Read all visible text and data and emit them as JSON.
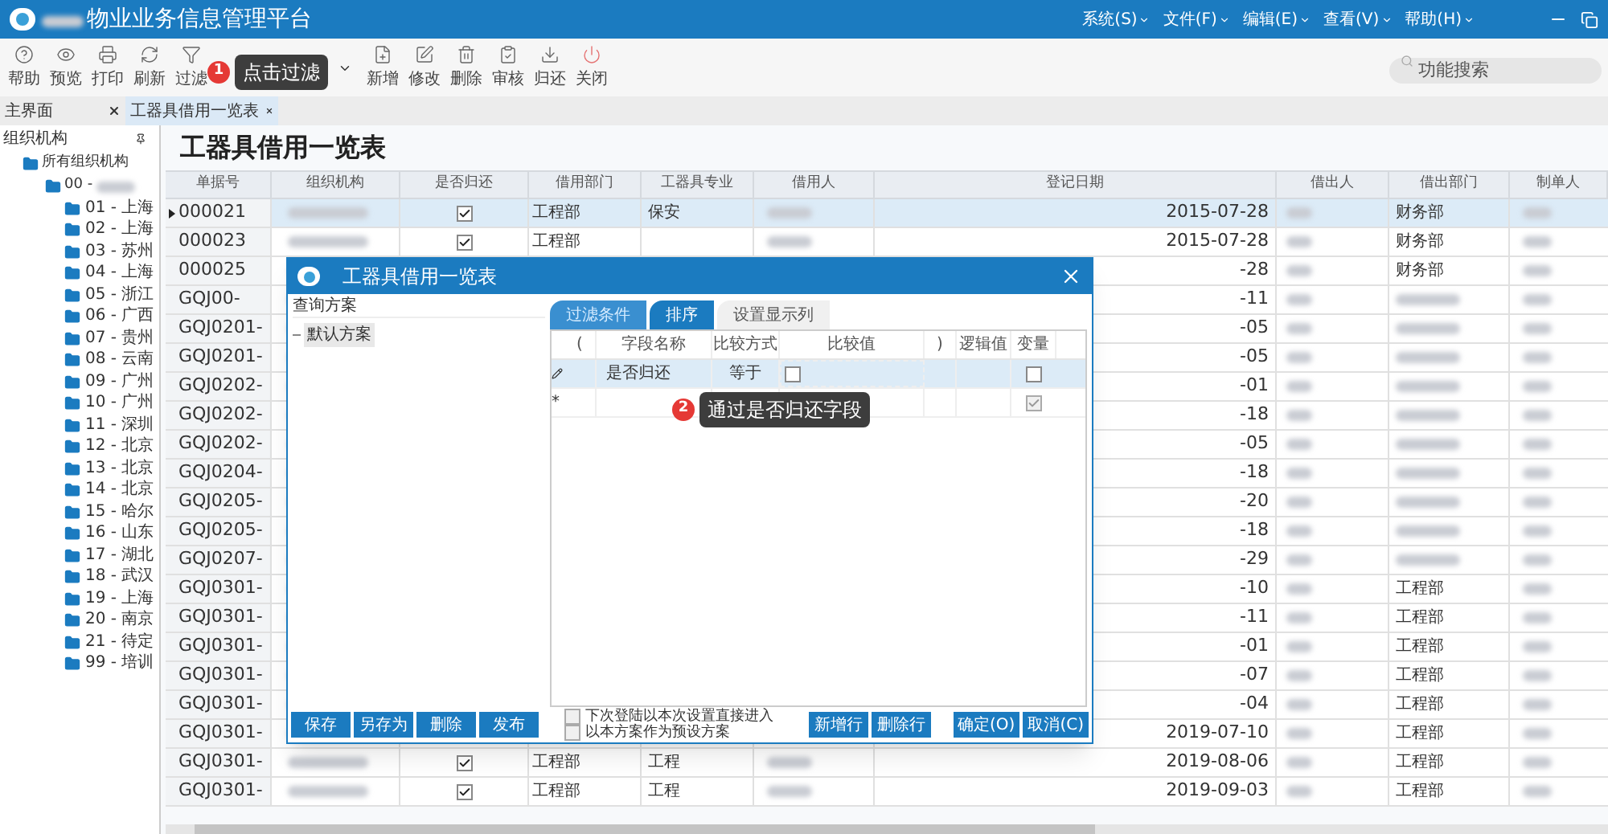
{
  "app": {
    "title": "物业业务信息管理平台",
    "menus": [
      "系统(S)",
      "文件(F)",
      "编辑(E)",
      "查看(V)",
      "帮助(H)"
    ]
  },
  "toolbar": {
    "buttons": [
      "帮助",
      "预览",
      "打印",
      "刷新",
      "过滤",
      "新增",
      "修改",
      "删除",
      "审核",
      "归还",
      "关闭"
    ],
    "callout": {
      "number": "1",
      "text": "点击过滤"
    },
    "search": {
      "placeholder": "功能搜索"
    }
  },
  "tabs": [
    {
      "label": "主界面",
      "selected": false
    },
    {
      "label": "工器具借用一览表",
      "selected": true
    }
  ],
  "tree": {
    "title": "组织机构",
    "root": {
      "label": "所有组织机构",
      "children": [
        {
          "label": "00 -",
          "children": [
            {
              "label": "01 - 上海"
            },
            {
              "label": "02 - 上海"
            },
            {
              "label": "03 - 苏州"
            },
            {
              "label": "04 - 上海"
            },
            {
              "label": "05 - 浙江"
            },
            {
              "label": "06 - 广西"
            },
            {
              "label": "07 - 贵州"
            },
            {
              "label": "08 - 云南"
            },
            {
              "label": "09 - 广州"
            },
            {
              "label": "10 - 广州"
            },
            {
              "label": "11 - 深圳"
            },
            {
              "label": "12 - 北京"
            },
            {
              "label": "13 - 北京"
            },
            {
              "label": "14 - 北京"
            },
            {
              "label": "15 - 哈尔"
            },
            {
              "label": "16 - 山东"
            },
            {
              "label": "17 - 湖北"
            },
            {
              "label": "18 - 武汉"
            },
            {
              "label": "19 - 上海"
            },
            {
              "label": "20 - 南京"
            },
            {
              "label": "21 - 待定"
            },
            {
              "label": "99 - 培训"
            }
          ]
        }
      ]
    }
  },
  "page_title": "工器具借用一览表",
  "table": {
    "columns": [
      "单据号",
      "组织机构",
      "是否归还",
      "借用部门",
      "工器具专业",
      "借用人",
      "登记日期",
      "借出人",
      "借出部门",
      "制单人"
    ],
    "rows": [
      {
        "id": "000021",
        "returned": true,
        "dept": "工程部",
        "specialty": "保安",
        "date": "2015-07-28",
        "lender_dept": "财务部",
        "selected": true
      },
      {
        "id": "000023",
        "returned": true,
        "dept": "工程部",
        "date": "2015-07-28",
        "lender_dept": "财务部",
        "selected": false
      },
      {
        "id": "000025",
        "date": "-28",
        "lender_dept": "财务部",
        "selected": false
      },
      {
        "id": "GQJ00-",
        "date": "-11",
        "selected": false
      },
      {
        "id": "GQJ0201-",
        "date": "-05",
        "selected": false
      },
      {
        "id": "GQJ0201-",
        "date": "-05",
        "selected": false
      },
      {
        "id": "GQJ0202-",
        "date": "-01",
        "selected": false
      },
      {
        "id": "GQJ0202-",
        "date": "-18",
        "selected": false
      },
      {
        "id": "GQJ0202-",
        "date": "-05",
        "selected": false
      },
      {
        "id": "GQJ0204-",
        "date": "-18",
        "selected": false
      },
      {
        "id": "GQJ0205-",
        "date": "-20",
        "selected": false
      },
      {
        "id": "GQJ0205-",
        "date": "-18",
        "selected": false
      },
      {
        "id": "GQJ0207-",
        "date": "-29",
        "selected": false
      },
      {
        "id": "GQJ0301-",
        "date": "-10",
        "lender_dept": "工程部",
        "selected": false
      },
      {
        "id": "GQJ0301-",
        "date": "-11",
        "lender_dept": "工程部",
        "selected": false
      },
      {
        "id": "GQJ0301-",
        "date": "-01",
        "lender_dept": "工程部",
        "selected": false
      },
      {
        "id": "GQJ0301-",
        "date": "-07",
        "lender_dept": "工程部",
        "selected": false
      },
      {
        "id": "GQJ0301-",
        "date": "-04",
        "lender_dept": "工程部",
        "selected": false
      },
      {
        "id": "GQJ0301-",
        "date": "2019-07-10",
        "lender_dept": "工程部",
        "selected": false
      },
      {
        "id": "GQJ0301-",
        "returned": true,
        "dept": "工程部",
        "specialty": "工程",
        "date": "2019-08-06",
        "lender_dept": "工程部",
        "selected": false
      },
      {
        "id": "GQJ0301-",
        "returned": true,
        "dept": "工程部",
        "specialty": "工程",
        "date": "2019-09-03",
        "lender_dept": "工程部",
        "selected": false
      }
    ]
  },
  "dialog": {
    "title": "工器具借用一览表",
    "scheme_label": "查询方案",
    "schemes": [
      {
        "label": "默认方案",
        "selected": true
      }
    ],
    "tabs": [
      {
        "label": "过滤条件",
        "kind": "blue",
        "selected": true
      },
      {
        "label": "排序",
        "kind": "blue",
        "selected": false
      },
      {
        "label": "设置显示列",
        "kind": "plain",
        "selected": false
      }
    ],
    "grid": {
      "columns": [
        "(",
        "字段名称",
        "比较方式",
        "比较值",
        ")",
        "逻辑值",
        "变量"
      ],
      "rows": [
        {
          "kind": "editing",
          "field": "是否归还",
          "operator": "等于",
          "value_checked": false,
          "variable": false
        },
        {
          "kind": "new",
          "marker": "*",
          "variable": true
        }
      ]
    },
    "callout": {
      "number": "2",
      "text": "通过是否归还字段"
    },
    "scheme_buttons": [
      "保存",
      "另存为",
      "删除",
      "发布"
    ],
    "options": [
      {
        "label": "下次登陆以本次设置直接进入",
        "checked": false
      },
      {
        "label": "以本方案作为预设方案",
        "checked": false
      }
    ],
    "row_buttons": [
      "新增行",
      "删除行"
    ],
    "confirm_buttons": [
      "确定(O)",
      "取消(C)"
    ]
  }
}
